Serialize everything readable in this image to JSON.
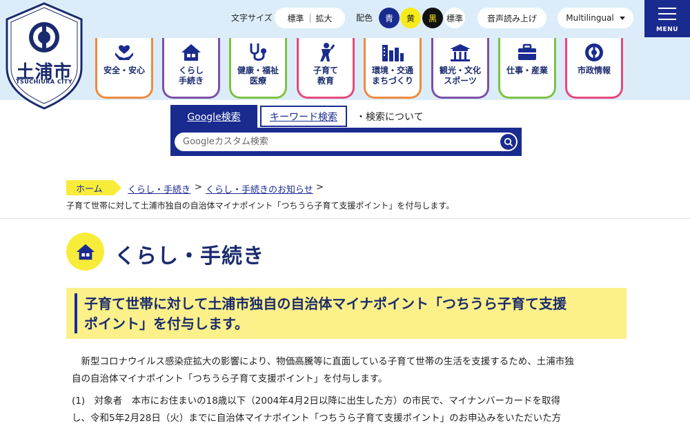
{
  "logo": {
    "name": "土浦市",
    "sub": "TSUCHIURA CITY"
  },
  "utility": {
    "font_size_label": "文字サイズ",
    "font_standard": "標準",
    "font_large": "拡大",
    "color_label": "配色",
    "color_blue": "青",
    "color_yellow": "黄",
    "color_black": "黒",
    "color_standard": "標準",
    "voice": "音声読み上げ",
    "multilingual": "Multilingual",
    "menu": "MENU"
  },
  "nav": [
    {
      "label": "安全・安心",
      "icon": "safety-hands-heart-icon",
      "color": "#f08a3c"
    },
    {
      "label": "くらし\n手続き",
      "icon": "house-icon",
      "color": "#7b4fa8"
    },
    {
      "label": "健康・福祉\n医療",
      "icon": "stethoscope-icon",
      "color": "#7dc242"
    },
    {
      "label": "子育て\n教育",
      "icon": "child-icon",
      "color": "#e8477a"
    },
    {
      "label": "環境・交通\nまちづくり",
      "icon": "city-buildings-icon",
      "color": "#f08a3c"
    },
    {
      "label": "観光・文化\nスポーツ",
      "icon": "temple-icon",
      "color": "#7b4fa8"
    },
    {
      "label": "仕事・産業",
      "icon": "briefcase-icon",
      "color": "#7dc242"
    },
    {
      "label": "市政情報",
      "icon": "city-emblem-icon",
      "color": "#e8477a"
    }
  ],
  "search": {
    "tab_google": "Google検索",
    "tab_keyword": "キーワード検索",
    "about": "・検索について",
    "placeholder": "Googleカスタム検索"
  },
  "breadcrumb": {
    "home": "ホーム",
    "items": [
      "くらし・手続き",
      "くらし・手続きのお知らせ"
    ],
    "sep": ">",
    "current": "子育て世帯に対して土浦市独自の自治体マイナポイント「つちうら子育て支援ポイント」を付与します。"
  },
  "category": {
    "title": "くらし・手続き"
  },
  "article": {
    "heading_line1": "子育て世帯に対して土浦市独自の自治体マイナポイント「つちうら子育て支援",
    "heading_line2": "ポイント」を付与します。",
    "p1_line1": "　新型コロナウイルス感染症拡大の影響により、物価高騰等に直面している子育て世帯の生活を支援するため、土浦市独",
    "p1_line2": "自の自治体マイナポイント「つちうら子育て支援ポイント」を付与します。",
    "p2_line1": "(1)　対象者　本市にお住まいの18歳以下（2004年4月2日以降に出生した方）の市民で、マイナンバーカードを取得",
    "p2_line2": "し、令和5年2月28日（火）までに自治体マイナポイント「つちうら子育て支援ポイント」のお申込みをいただいた方"
  },
  "colors": {
    "navy": "#1a2b8f",
    "yellow": "#f8ec3a",
    "header_bg": "#dcedf9"
  }
}
